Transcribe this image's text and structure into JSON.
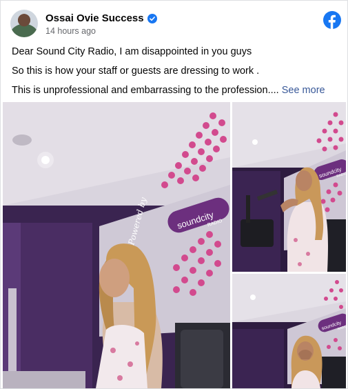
{
  "post": {
    "author": "Ossai Ovie Success",
    "timestamp": "14 hours ago",
    "paragraphs": [
      "Dear Sound City Radio, I am disappointed in you guys",
      "So this is how your staff or guests are dressing to work .",
      "This is unprofessional and embarrassing to the profession...."
    ],
    "see_more": "See more"
  },
  "photos": {
    "main": {
      "sign_brand": "soundcity",
      "sign_sub": "RADIO",
      "script_text": "Powered by"
    },
    "top": {
      "sign_brand": "soundcity",
      "sign_sub": "RADIO"
    },
    "bottom": {
      "sign_brand": "soundcity",
      "sign_sub": "RADIO"
    }
  },
  "colors": {
    "facebook_blue": "#1877f2",
    "verified_blue": "#1877f2",
    "link": "#385898",
    "studio_purple": "#3b2452",
    "sign_purple": "#6c2f7e",
    "dot_pink": "#d24a8e"
  },
  "icons": [
    "verified-badge-icon",
    "facebook-logo-icon"
  ]
}
